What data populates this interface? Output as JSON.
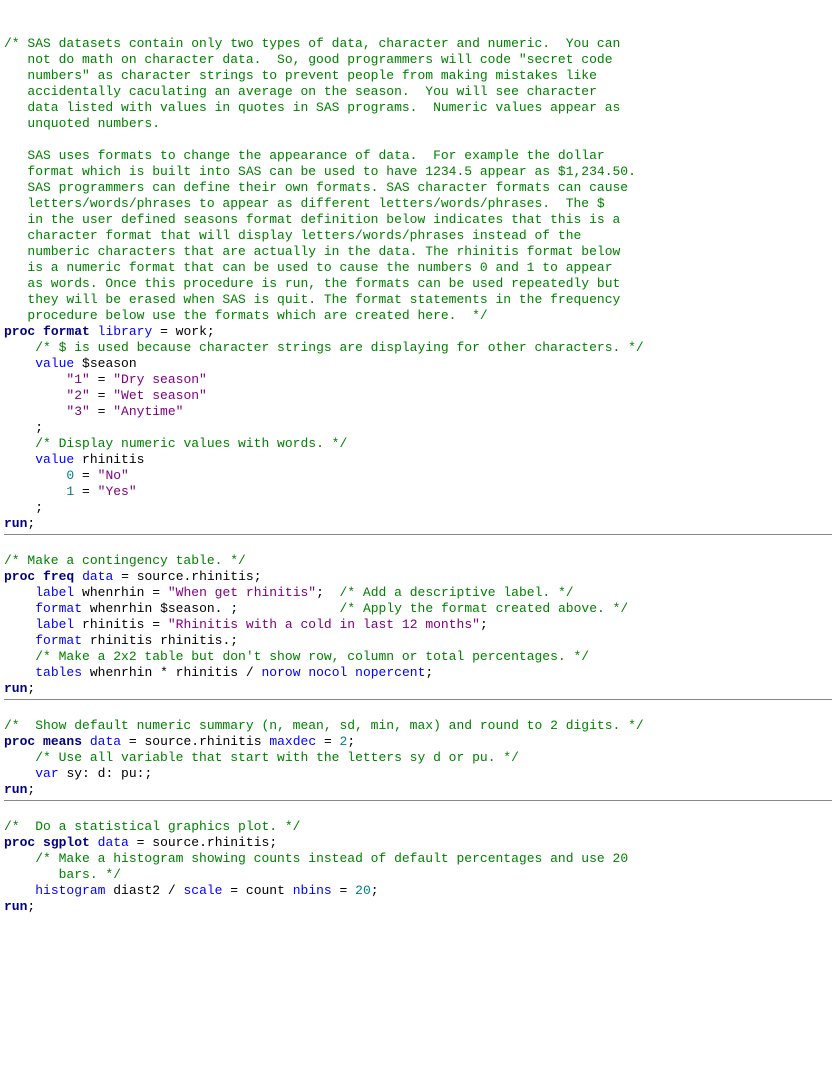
{
  "c1": "/* SAS datasets contain only two types of data, character and numeric.  You can\n   not do math on character data.  So, good programmers will code \"secret code\n   numbers\" as character strings to prevent people from making mistakes like\n   accidentally caculating an average on the season.  You will see character\n   data listed with values in quotes in SAS programs.  Numeric values appear as\n   unquoted numbers.\n\n   SAS uses formats to change the appearance of data.  For example the dollar\n   format which is built into SAS can be used to have 1234.5 appear as $1,234.50.\n   SAS programmers can define their own formats. SAS character formats can cause\n   letters/words/phrases to appear as different letters/words/phrases.  The $\n   in the user defined seasons format definition below indicates that this is a\n   character format that will display letters/words/phrases instead of the\n   numberic characters that are actually in the data. The rhinitis format below\n   is a numeric format that can be used to cause the numbers 0 and 1 to appear\n   as words. Once this procedure is run, the formats can be used repeatedly but\n   they will be erased when SAS is quit. The format statements in the frequency\n   procedure below use the formats which are created here.  */",
  "proc": "proc",
  "run": "run",
  "format": "format",
  "library": "library",
  "work": "work",
  "value": "value",
  "freq": "freq",
  "data_kw": "data",
  "means": "means",
  "sgplot": "sgplot",
  "label": "label",
  "tables": "tables",
  "var": "var",
  "histogram": "histogram",
  "c2": "/* $ is used because character strings are displaying for other characters. */",
  "season_fmt": "$season",
  "s1k": "\"1\"",
  "s1v": "\"Dry season\"",
  "s2k": "\"2\"",
  "s2v": "\"Wet season\"",
  "s3k": "\"3\"",
  "s3v": "\"Anytime\"",
  "c3": "/* Display numeric values with words. */",
  "rhinitis_fmt": "rhinitis",
  "n0": "0",
  "no": "\"No\"",
  "n1": "1",
  "yes": "\"Yes\"",
  "c4": "/* Make a contingency table. */",
  "source_rhinitis": "source.rhinitis",
  "whenrhin": "whenrhin",
  "when_label": "\"When get rhinitis\"",
  "c5": "/* Add a descriptive label. */",
  "season_apply": "$season.",
  "c6": "/* Apply the format created above. */",
  "rhinitis_var": "rhinitis",
  "rhin_label": "\"Rhinitis with a cold in last 12 months\"",
  "rhinitis_apply": "rhinitis.",
  "c7": "/* Make a 2x2 table but don't show row, column or total percentages. */",
  "norow": "norow",
  "nocol": "nocol",
  "nopercent": "nopercent",
  "c8": "/*  Show default numeric summary (n, mean, sd, min, max) and round to 2 digits. */",
  "maxdec": "maxdec",
  "two": "2",
  "c9": "/* Use all variable that start with the letters sy d or pu. */",
  "varlist": "sy: d: pu:",
  "c10": "/*  Do a statistical graphics plot. */",
  "c11": "/* Make a histogram showing counts instead of default percentages and use 20\n       bars. */",
  "diast2": "diast2",
  "scale": "scale",
  "count": "count",
  "nbins": "nbins",
  "twenty": "20",
  "eq": " = ",
  "semi": ";",
  "star": " * ",
  "slash": " / "
}
